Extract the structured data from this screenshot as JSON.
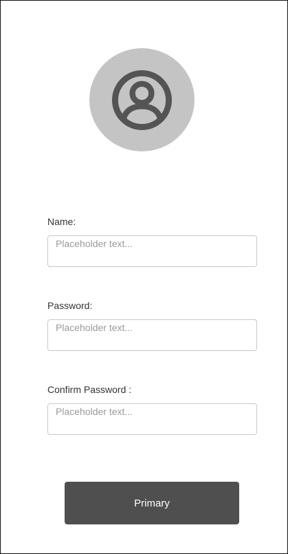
{
  "avatar": {
    "icon": "user-circle-icon",
    "background_color": "#c4c4c4",
    "icon_color": "#545454"
  },
  "form": {
    "fields": [
      {
        "label": "Name:",
        "placeholder": "Placeholder text..."
      },
      {
        "label": "Password:",
        "placeholder": "Placeholder text..."
      },
      {
        "label": "Confirm Password :",
        "placeholder": "Placeholder text..."
      }
    ]
  },
  "primary_button": {
    "label": "Primary",
    "color": "#4f4f4f"
  }
}
